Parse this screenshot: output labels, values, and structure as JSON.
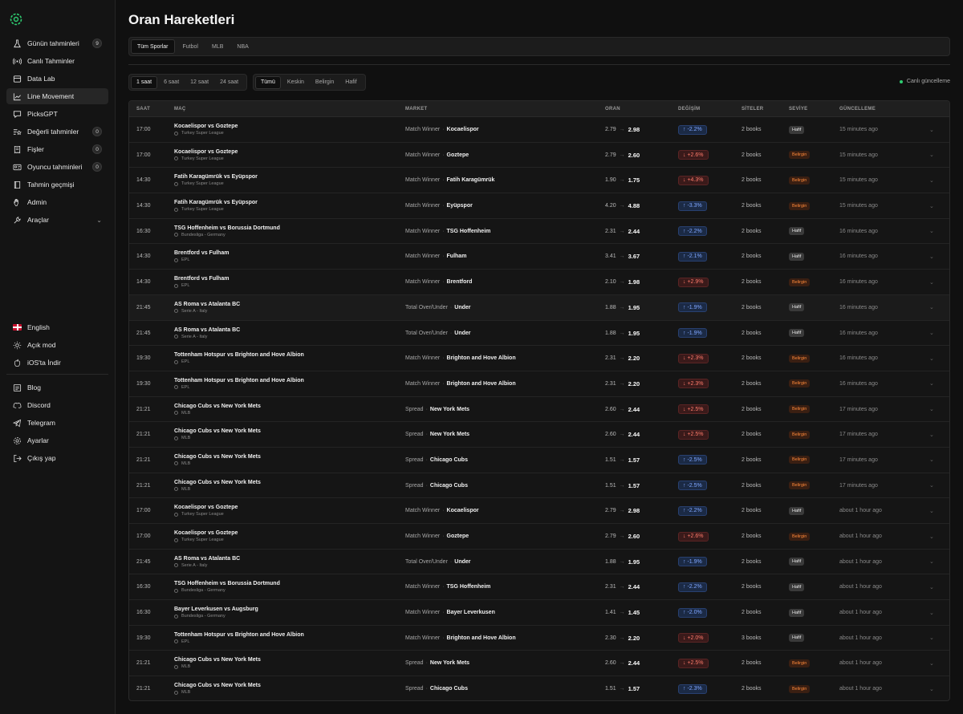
{
  "sidebar": {
    "logo_icon": "brand-logo-icon",
    "nav": [
      {
        "label": "Günün tahminleri",
        "icon": "flask-icon",
        "badge": "9"
      },
      {
        "label": "Canlı Tahminler",
        "icon": "broadcast-icon",
        "badge": ""
      },
      {
        "label": "Data Lab",
        "icon": "database-icon",
        "badge": ""
      },
      {
        "label": "Line Movement",
        "icon": "chart-line-icon",
        "badge": "",
        "active": true
      },
      {
        "label": "PicksGPT",
        "icon": "chat-icon",
        "badge": ""
      },
      {
        "label": "Değerli tahminler",
        "icon": "star-list-icon",
        "badge": "0"
      },
      {
        "label": "Fişler",
        "icon": "receipt-icon",
        "badge": "0"
      },
      {
        "label": "Oyuncu tahminleri",
        "icon": "id-card-icon",
        "badge": "0"
      },
      {
        "label": "Tahmin geçmişi",
        "icon": "book-icon",
        "badge": ""
      },
      {
        "label": "Admin",
        "icon": "hand-icon",
        "badge": ""
      },
      {
        "label": "Araçlar",
        "icon": "wrench-icon",
        "badge": "",
        "chevron": true
      }
    ],
    "bottom": {
      "language": "English",
      "theme": "Açık mod",
      "ios": "iOS'ta İndir",
      "links": [
        "Blog",
        "Discord",
        "Telegram",
        "Ayarlar",
        "Çıkış yap"
      ]
    }
  },
  "page": {
    "title": "Oran Hareketleri",
    "sport_tabs": [
      "Tüm Sporlar",
      "Futbol",
      "MLB",
      "NBA"
    ],
    "time_tabs": [
      "1 saat",
      "6 saat",
      "12 saat",
      "24 saat"
    ],
    "level_tabs": [
      "Tümü",
      "Keskin",
      "Belirgin",
      "Hafif"
    ],
    "live_label": "Canlı güncelleme"
  },
  "table": {
    "headers": [
      "SAAT",
      "MAÇ",
      "MARKET",
      "ORAN",
      "DEĞİŞİM",
      "SİTELER",
      "SEVİYE",
      "GÜNCELLEME"
    ],
    "rows": [
      {
        "time": "17:00",
        "match": "Kocaelispor vs Goztepe",
        "league": "Turkey Super League",
        "market": "Match Winner",
        "selection": "Kocaelispor",
        "old": "2.79",
        "new": "2.98",
        "change": "↑ -2.2%",
        "dir": "down",
        "sites": "2 books",
        "level": "Hafif",
        "updated": "15 minutes ago"
      },
      {
        "time": "17:00",
        "match": "Kocaelispor vs Goztepe",
        "league": "Turkey Super League",
        "market": "Match Winner",
        "selection": "Goztepe",
        "old": "2.79",
        "new": "2.60",
        "change": "↓ +2.6%",
        "dir": "up",
        "sites": "2 books",
        "level": "Belirgin",
        "updated": "15 minutes ago"
      },
      {
        "time": "14:30",
        "match": "Fatih Karagümrük vs Eyüpspor",
        "league": "Turkey Super League",
        "market": "Match Winner",
        "selection": "Fatih Karagümrük",
        "old": "1.90",
        "new": "1.75",
        "change": "↓ +4.3%",
        "dir": "up",
        "sites": "2 books",
        "level": "Belirgin",
        "updated": "15 minutes ago"
      },
      {
        "time": "14:30",
        "match": "Fatih Karagümrük vs Eyüpspor",
        "league": "Turkey Super League",
        "market": "Match Winner",
        "selection": "Eyüpspor",
        "old": "4.20",
        "new": "4.88",
        "change": "↑ -3.3%",
        "dir": "down",
        "sites": "2 books",
        "level": "Belirgin",
        "updated": "15 minutes ago"
      },
      {
        "time": "16:30",
        "match": "TSG Hoffenheim vs Borussia Dortmund",
        "league": "Bundesliga - Germany",
        "market": "Match Winner",
        "selection": "TSG Hoffenheim",
        "old": "2.31",
        "new": "2.44",
        "change": "↑ -2.2%",
        "dir": "down",
        "sites": "2 books",
        "level": "Hafif",
        "updated": "16 minutes ago"
      },
      {
        "time": "14:30",
        "match": "Brentford vs Fulham",
        "league": "EPL",
        "market": "Match Winner",
        "selection": "Fulham",
        "old": "3.41",
        "new": "3.67",
        "change": "↑ -2.1%",
        "dir": "down",
        "sites": "2 books",
        "level": "Hafif",
        "updated": "16 minutes ago"
      },
      {
        "time": "14:30",
        "match": "Brentford vs Fulham",
        "league": "EPL",
        "market": "Match Winner",
        "selection": "Brentford",
        "old": "2.10",
        "new": "1.98",
        "change": "↓ +2.9%",
        "dir": "up",
        "sites": "2 books",
        "level": "Belirgin",
        "updated": "16 minutes ago"
      },
      {
        "time": "21:45",
        "match": "AS Roma vs Atalanta BC",
        "league": "Serie A - Italy",
        "market": "Total Over/Under",
        "selection": "Under",
        "old": "1.88",
        "new": "1.95",
        "change": "↑ -1.9%",
        "dir": "down",
        "sites": "2 books",
        "level": "Hafif",
        "updated": "16 minutes ago",
        "hl": true
      },
      {
        "time": "21:45",
        "match": "AS Roma vs Atalanta BC",
        "league": "Serie A - Italy",
        "market": "Total Over/Under",
        "selection": "Under",
        "old": "1.88",
        "new": "1.95",
        "change": "↑ -1.9%",
        "dir": "down",
        "sites": "2 books",
        "level": "Hafif",
        "updated": "16 minutes ago"
      },
      {
        "time": "19:30",
        "match": "Tottenham Hotspur vs Brighton and Hove Albion",
        "league": "EPL",
        "market": "Match Winner",
        "selection": "Brighton and Hove Albion",
        "old": "2.31",
        "new": "2.20",
        "change": "↓ +2.3%",
        "dir": "up",
        "sites": "2 books",
        "level": "Belirgin",
        "updated": "16 minutes ago"
      },
      {
        "time": "19:30",
        "match": "Tottenham Hotspur vs Brighton and Hove Albion",
        "league": "EPL",
        "market": "Match Winner",
        "selection": "Brighton and Hove Albion",
        "old": "2.31",
        "new": "2.20",
        "change": "↓ +2.3%",
        "dir": "up",
        "sites": "2 books",
        "level": "Belirgin",
        "updated": "16 minutes ago"
      },
      {
        "time": "21:21",
        "match": "Chicago Cubs vs New York Mets",
        "league": "MLB",
        "market": "Spread",
        "selection": "New York Mets",
        "old": "2.60",
        "new": "2.44",
        "change": "↓ +2.5%",
        "dir": "up",
        "sites": "2 books",
        "level": "Belirgin",
        "updated": "17 minutes ago"
      },
      {
        "time": "21:21",
        "match": "Chicago Cubs vs New York Mets",
        "league": "MLB",
        "market": "Spread",
        "selection": "New York Mets",
        "old": "2.60",
        "new": "2.44",
        "change": "↓ +2.5%",
        "dir": "up",
        "sites": "2 books",
        "level": "Belirgin",
        "updated": "17 minutes ago"
      },
      {
        "time": "21:21",
        "match": "Chicago Cubs vs New York Mets",
        "league": "MLB",
        "market": "Spread",
        "selection": "Chicago Cubs",
        "old": "1.51",
        "new": "1.57",
        "change": "↑ -2.5%",
        "dir": "down",
        "sites": "2 books",
        "level": "Belirgin",
        "updated": "17 minutes ago"
      },
      {
        "time": "21:21",
        "match": "Chicago Cubs vs New York Mets",
        "league": "MLB",
        "market": "Spread",
        "selection": "Chicago Cubs",
        "old": "1.51",
        "new": "1.57",
        "change": "↑ -2.5%",
        "dir": "down",
        "sites": "2 books",
        "level": "Belirgin",
        "updated": "17 minutes ago"
      },
      {
        "time": "17:00",
        "match": "Kocaelispor vs Goztepe",
        "league": "Turkey Super League",
        "market": "Match Winner",
        "selection": "Kocaelispor",
        "old": "2.79",
        "new": "2.98",
        "change": "↑ -2.2%",
        "dir": "down",
        "sites": "2 books",
        "level": "Hafif",
        "updated": "about 1 hour ago"
      },
      {
        "time": "17:00",
        "match": "Kocaelispor vs Goztepe",
        "league": "Turkey Super League",
        "market": "Match Winner",
        "selection": "Goztepe",
        "old": "2.79",
        "new": "2.60",
        "change": "↓ +2.6%",
        "dir": "up",
        "sites": "2 books",
        "level": "Belirgin",
        "updated": "about 1 hour ago"
      },
      {
        "time": "21:45",
        "match": "AS Roma vs Atalanta BC",
        "league": "Serie A - Italy",
        "market": "Total Over/Under",
        "selection": "Under",
        "old": "1.88",
        "new": "1.95",
        "change": "↑ -1.9%",
        "dir": "down",
        "sites": "2 books",
        "level": "Hafif",
        "updated": "about 1 hour ago"
      },
      {
        "time": "16:30",
        "match": "TSG Hoffenheim vs Borussia Dortmund",
        "league": "Bundesliga - Germany",
        "market": "Match Winner",
        "selection": "TSG Hoffenheim",
        "old": "2.31",
        "new": "2.44",
        "change": "↑ -2.2%",
        "dir": "down",
        "sites": "2 books",
        "level": "Hafif",
        "updated": "about 1 hour ago"
      },
      {
        "time": "16:30",
        "match": "Bayer Leverkusen vs Augsburg",
        "league": "Bundesliga - Germany",
        "market": "Match Winner",
        "selection": "Bayer Leverkusen",
        "old": "1.41",
        "new": "1.45",
        "change": "↑ -2.0%",
        "dir": "down",
        "sites": "2 books",
        "level": "Hafif",
        "updated": "about 1 hour ago"
      },
      {
        "time": "19:30",
        "match": "Tottenham Hotspur vs Brighton and Hove Albion",
        "league": "EPL",
        "market": "Match Winner",
        "selection": "Brighton and Hove Albion",
        "old": "2.30",
        "new": "2.20",
        "change": "↓ +2.0%",
        "dir": "up",
        "sites": "3 books",
        "level": "Hafif",
        "updated": "about 1 hour ago"
      },
      {
        "time": "21:21",
        "match": "Chicago Cubs vs New York Mets",
        "league": "MLB",
        "market": "Spread",
        "selection": "New York Mets",
        "old": "2.60",
        "new": "2.44",
        "change": "↓ +2.5%",
        "dir": "up",
        "sites": "2 books",
        "level": "Belirgin",
        "updated": "about 1 hour ago"
      },
      {
        "time": "21:21",
        "match": "Chicago Cubs vs New York Mets",
        "league": "MLB",
        "market": "Spread",
        "selection": "Chicago Cubs",
        "old": "1.51",
        "new": "1.57",
        "change": "↑ -2.3%",
        "dir": "down",
        "sites": "2 books",
        "level": "Belirgin",
        "updated": "about 1 hour ago"
      }
    ]
  }
}
